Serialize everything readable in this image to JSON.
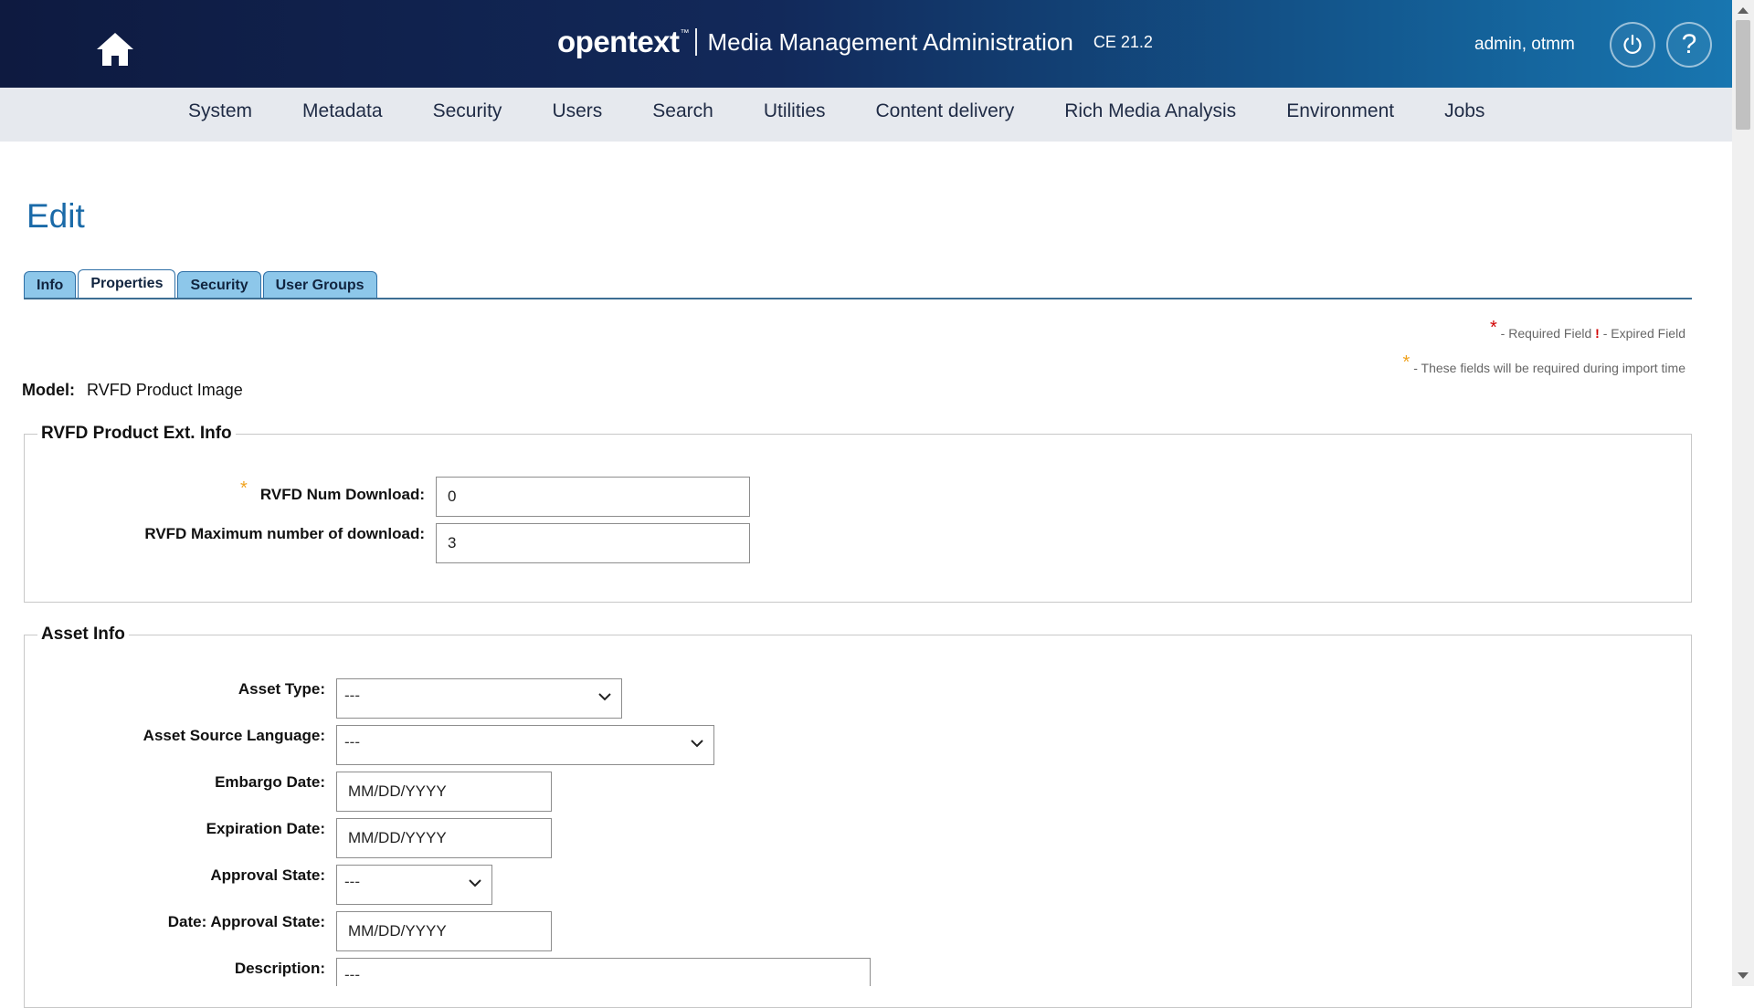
{
  "header": {
    "logo": "opentext",
    "logo_tm": "™",
    "app_title": "Media Management Administration",
    "version": "CE 21.2",
    "user": "admin, otmm",
    "help_label": "?"
  },
  "nav": {
    "items": [
      "System",
      "Metadata",
      "Security",
      "Users",
      "Search",
      "Utilities",
      "Content delivery",
      "Rich Media Analysis",
      "Environment",
      "Jobs"
    ]
  },
  "page": {
    "title": "Edit",
    "tabs": [
      "Info",
      "Properties",
      "Security",
      "User Groups"
    ],
    "active_tab": "Properties",
    "legend": {
      "required_star": "*",
      "required_text": "- Required Field",
      "expired_mark": "!",
      "expired_text": "- Expired Field",
      "import_star": "*",
      "import_text": "- These fields will be required during import time"
    },
    "model_label": "Model:",
    "model_value": "RVFD Product Image"
  },
  "sections": {
    "rvfd": {
      "title": "RVFD Product Ext. Info",
      "num_download_star": "*",
      "num_download_label": "RVFD Num Download:",
      "num_download_value": "0",
      "max_download_label": "RVFD Maximum number of download:",
      "max_download_value": "3"
    },
    "asset": {
      "title": "Asset Info",
      "asset_type_label": "Asset Type:",
      "asset_type_value": "---",
      "source_lang_label": "Asset Source Language:",
      "source_lang_value": "---",
      "embargo_label": "Embargo Date:",
      "embargo_placeholder": "MM/DD/YYYY",
      "expiration_label": "Expiration Date:",
      "expiration_placeholder": "MM/DD/YYYY",
      "approval_label": "Approval State:",
      "approval_value": "---",
      "approval_date_label": "Date: Approval State:",
      "approval_date_placeholder": "MM/DD/YYYY",
      "description_label": "Description:",
      "description_value": "---"
    }
  },
  "colors": {
    "header_dark": "#0e1a40",
    "header_light": "#1876b0",
    "title_blue": "#1a6aa8",
    "tab_blue": "#8dc7ea",
    "required_red": "#d10000",
    "import_orange": "#f0a320"
  }
}
